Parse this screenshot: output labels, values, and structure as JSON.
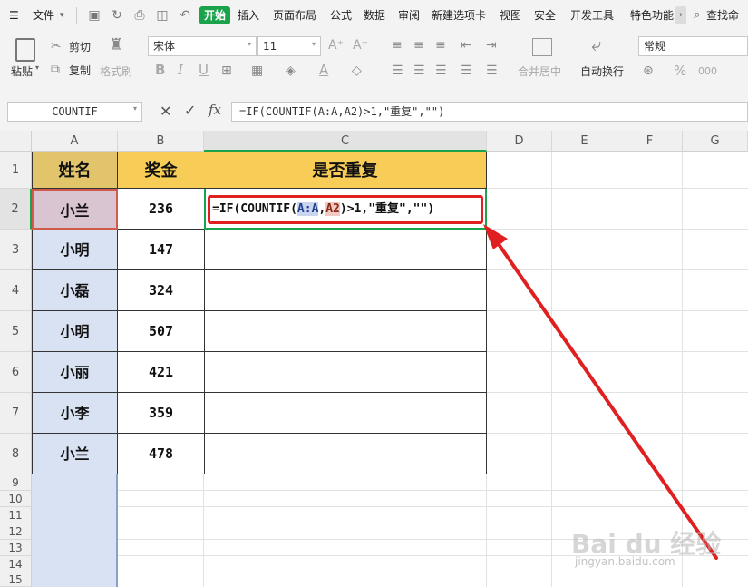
{
  "menubar": {
    "file_label": "文件",
    "tabs": [
      "开始",
      "插入",
      "页面布局",
      "公式",
      "数据",
      "审阅",
      "新建选项卡",
      "视图",
      "安全",
      "开发工具",
      "特色功能"
    ],
    "search_label": "查找命"
  },
  "ribbon": {
    "paste_label": "粘贴",
    "cut_label": "剪切",
    "copy_label": "复制",
    "format_painter_label": "格式刷",
    "font_name": "宋体",
    "font_size": "11",
    "merge_label": "合并居中",
    "wrap_label": "自动换行",
    "number_format": "常规",
    "bold_glyph": "B",
    "italic_glyph": "I",
    "underline_glyph": "U",
    "font_grow_glyph": "A⁺",
    "font_shrink_glyph": "A⁻",
    "percent_glyph": "%",
    "thousand_glyph": "000"
  },
  "formula_bar": {
    "name_box": "COUNTIF",
    "fx_label": "fx",
    "formula": "=IF(COUNTIF(A:A,A2)>1,\"重复\",\"\")"
  },
  "columns": [
    "A",
    "B",
    "C",
    "D",
    "E",
    "F",
    "G"
  ],
  "rows": [
    "1",
    "2",
    "3",
    "4",
    "5",
    "6",
    "7",
    "8",
    "9",
    "10",
    "11",
    "12",
    "13",
    "14",
    "15"
  ],
  "table": {
    "headers": [
      "姓名",
      "奖金",
      "是否重复"
    ],
    "names": [
      "小兰",
      "小明",
      "小磊",
      "小明",
      "小丽",
      "小李",
      "小兰"
    ],
    "bonus": [
      "236",
      "147",
      "324",
      "507",
      "421",
      "359",
      "478"
    ]
  },
  "editing_cell": {
    "prefix": "=IF(COUNTIF(",
    "ref1": "A:A",
    "comma": ",",
    "ref2": "A2",
    "suffix": ")>1,\"重复\",\"\")"
  },
  "watermark": {
    "brand": "Bai du 经验",
    "url": "jingyan.baidu.com"
  },
  "colors": {
    "header_fill": "#f7cd58",
    "name_col_fill": "#d9e2f3",
    "active_fill": "#d9c4d2",
    "accent_green": "#1aa34a",
    "annotation_red": "#e02020"
  }
}
